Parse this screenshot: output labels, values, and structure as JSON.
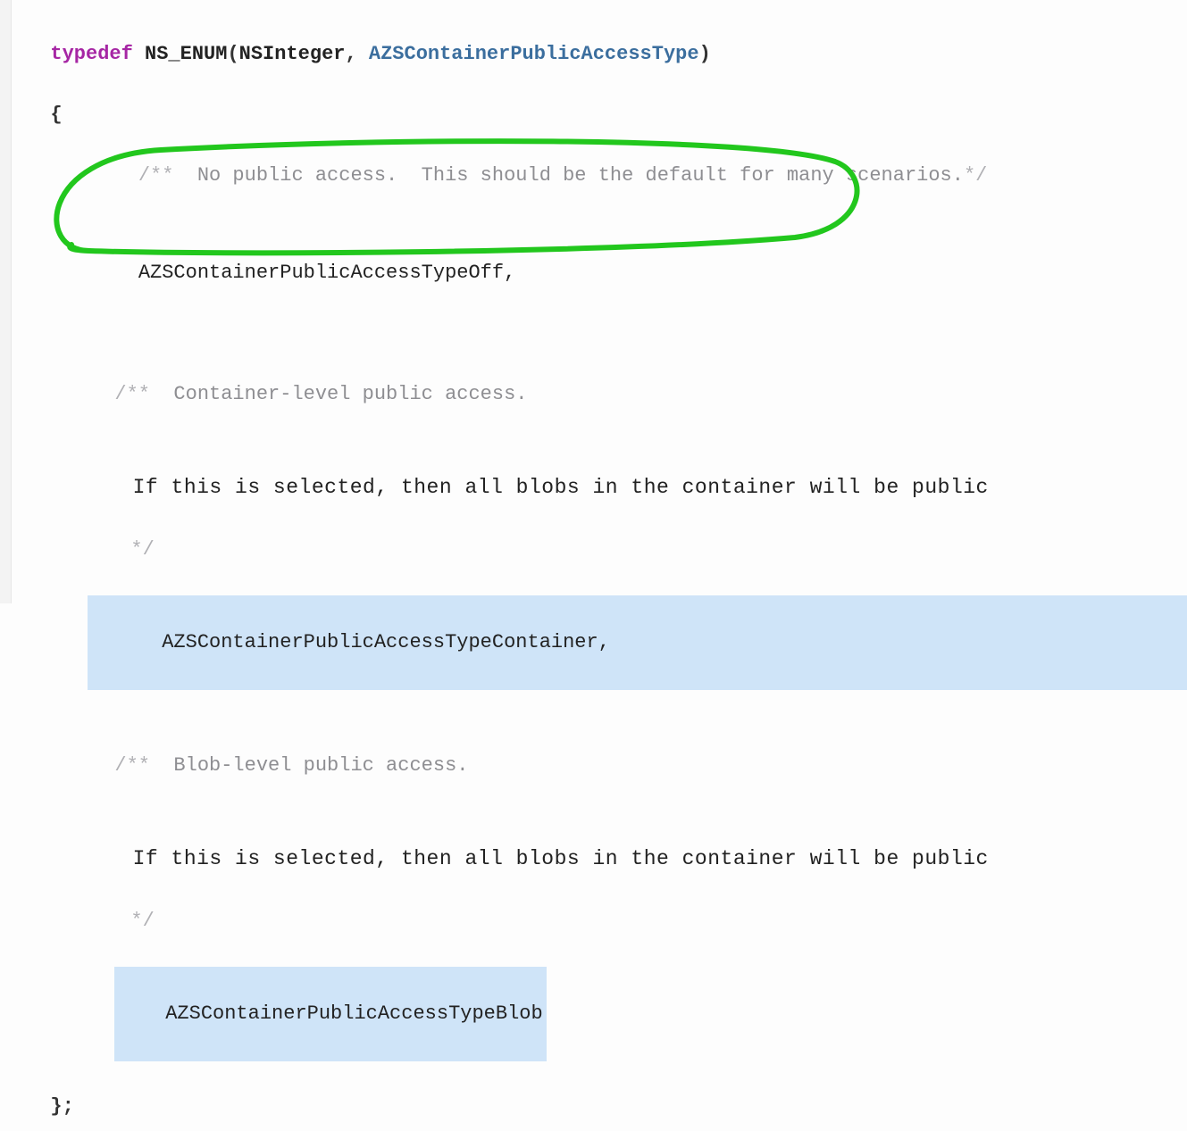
{
  "decl": {
    "typedef": "typedef",
    "ns_enum": "NS_ENUM",
    "lparen": "(",
    "nsinteger": "NSInteger",
    "comma": ", ",
    "typename": "AZSContainerPublicAccessType",
    "rparen": ")"
  },
  "brace_open": "{",
  "brace_close": "};",
  "enum_off": {
    "comment_open": "/**",
    "comment_text": "  No public access.  This should be the default for many scenarios.",
    "comment_close": "*/",
    "value": "AZSContainerPublicAccessTypeOff,"
  },
  "enum_container": {
    "comment_open": "/**",
    "comment_title": "  Container-level public access.",
    "comment_body": "If this is selected, then all blobs in the container will be public",
    "comment_close": "*/",
    "value": "AZSContainerPublicAccessTypeContainer,"
  },
  "enum_blob": {
    "comment_open": "/**",
    "comment_title": "  Blob-level public access.",
    "comment_body": "If this is selected, then all blobs in the container will be public",
    "comment_close": "*/",
    "value": "AZSContainerPublicAccessTypeBlob"
  },
  "annotation": {
    "stroke": "#22c71d",
    "stroke_width": 5
  }
}
